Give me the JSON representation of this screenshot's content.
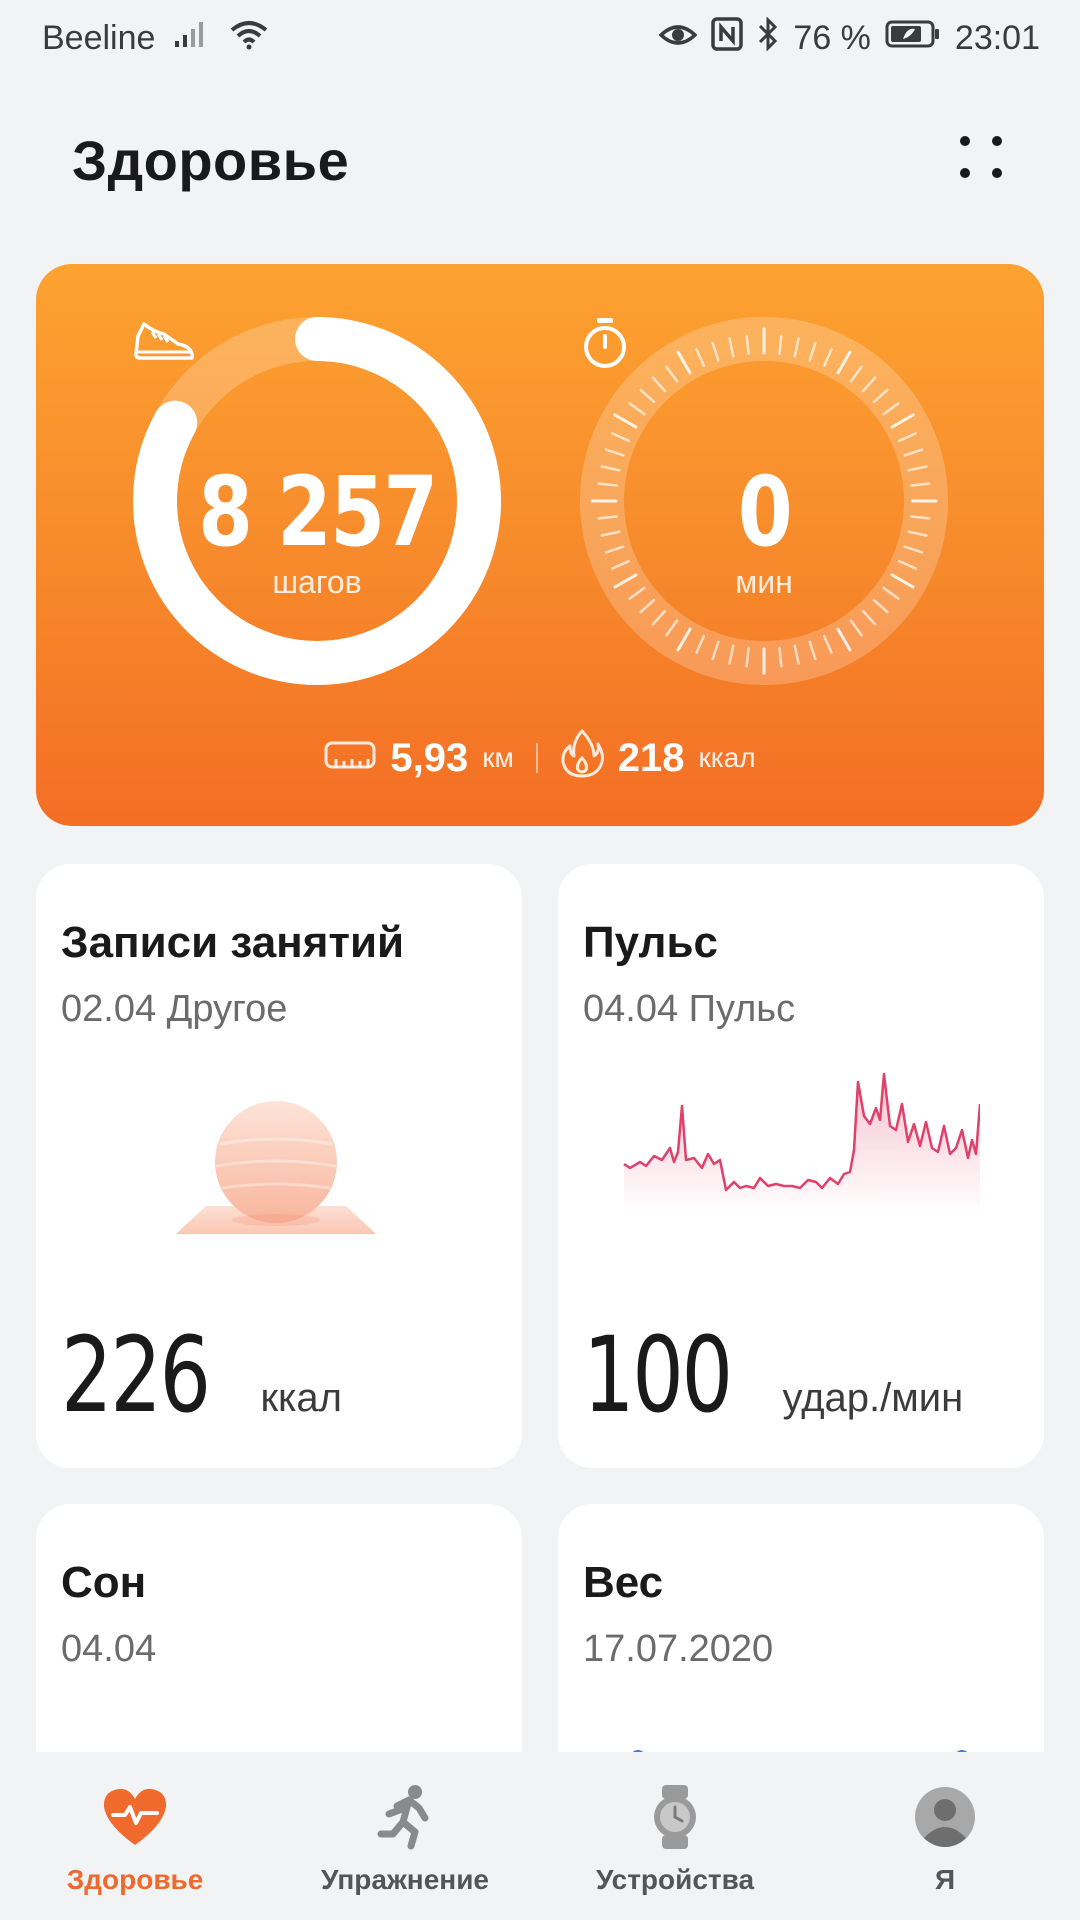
{
  "status_bar": {
    "carrier": "Beeline",
    "battery": "76 %",
    "time": "23:01"
  },
  "header": {
    "title": "Здоровье"
  },
  "activity": {
    "steps": {
      "value": "8 257",
      "unit": "шагов",
      "progress": 0.83
    },
    "minutes": {
      "value": "0",
      "unit": "мин"
    },
    "distance": {
      "value": "5,93",
      "unit": "км"
    },
    "calories": {
      "value": "218",
      "unit": "ккал"
    }
  },
  "tiles": {
    "records": {
      "title": "Записи занятий",
      "subtitle": "02.04 Другое",
      "value": "226",
      "unit": "ккал"
    },
    "pulse": {
      "title": "Пульс",
      "subtitle": "04.04 Пульс",
      "value": "100",
      "unit": "удар./мин"
    },
    "sleep": {
      "title": "Сон",
      "subtitle": "04.04"
    },
    "weight": {
      "title": "Вес",
      "subtitle": "17.07.2020"
    }
  },
  "nav": {
    "items": [
      {
        "label": "Здоровье",
        "icon": "heart-pulse-icon",
        "active": true
      },
      {
        "label": "Упражнение",
        "icon": "running-icon",
        "active": false
      },
      {
        "label": "Устройства",
        "icon": "watch-icon",
        "active": false
      },
      {
        "label": "Я",
        "icon": "profile-icon",
        "active": false
      }
    ]
  },
  "colors": {
    "accent": "#ef6a2c",
    "card_top": "#fda230",
    "card_bottom": "#f46e24",
    "pulse_line": "#e0406a"
  }
}
